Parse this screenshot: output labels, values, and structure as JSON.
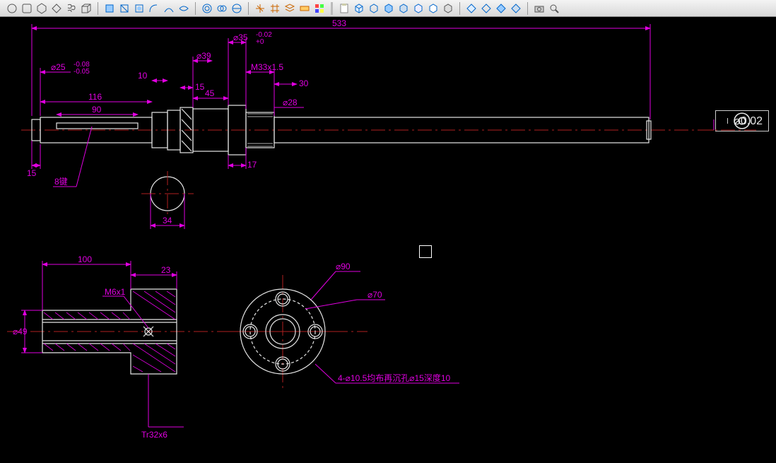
{
  "toolbar": {
    "groups": [
      [
        "circle",
        "rect",
        "polygon",
        "diamond",
        "coil",
        "box3d"
      ],
      [
        "box-a",
        "box-b",
        "box-c",
        "arc-a",
        "arc-b",
        "arc-c"
      ],
      [
        "ring-a",
        "ring-b",
        "ring-c"
      ],
      [
        "axis",
        "grid",
        "layers",
        "orient",
        "palette"
      ],
      [
        "sep"
      ],
      [
        "paste",
        "cube1",
        "cube2",
        "cube3",
        "cube4",
        "cube5",
        "cube6",
        "cube7"
      ],
      [
        "diamond1",
        "diamond2",
        "diamond3",
        "diamond4"
      ],
      [
        "camera",
        "zoom"
      ]
    ]
  },
  "dimensions": {
    "overall_length": "533",
    "d25": "⌀25",
    "d25_tol_upper": "-0.08",
    "d25_tol_lower": "-0.05",
    "d35": "⌀35",
    "d35_tol_upper": "-0.02",
    "d35_tol_lower": "+0",
    "d39": "⌀39",
    "m33": "M33x1.5",
    "d28": "⌀28",
    "len116": "116",
    "len90": "90",
    "len10": "10",
    "len15a": "15",
    "len45": "45",
    "len30": "30",
    "len15b": "15",
    "len17": "17",
    "len34": "34",
    "key8": "8键",
    "len100": "100",
    "len23": "23",
    "m6": "M6x1",
    "d49": "⌀49",
    "tr32": "Tr32x6",
    "d90": "⌀90",
    "d70": "⌀70",
    "hole_note": "4-⌀10.5均布再沉孔⌀15深度10"
  },
  "tolerance_frame": {
    "symbol": "◎",
    "value": "⌀0.02"
  }
}
